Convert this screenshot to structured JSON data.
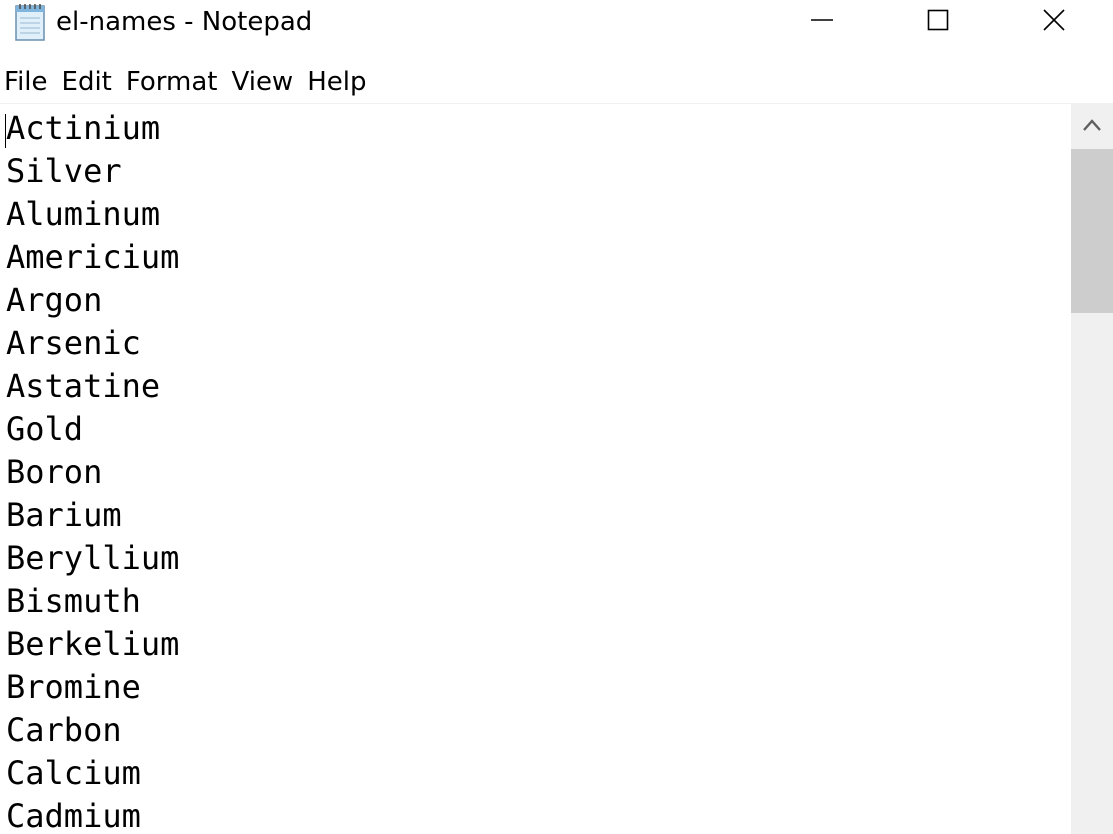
{
  "window": {
    "title": "el-names - Notepad",
    "icon": "notepad-icon",
    "controls": [
      "minimize-icon",
      "maximize-icon",
      "close-icon"
    ]
  },
  "menu": {
    "items": [
      "File",
      "Edit",
      "Format",
      "View",
      "Help"
    ]
  },
  "editor": {
    "lines": [
      "Actinium",
      "Silver",
      "Aluminum",
      "Americium",
      "Argon",
      "Arsenic",
      "Astatine",
      "Gold",
      "Boron",
      "Barium",
      "Beryllium",
      "Bismuth",
      "Berkelium",
      "Bromine",
      "Carbon",
      "Calcium",
      "Cadmium"
    ]
  },
  "scrollbar": {
    "up_icon": "chevron-up-icon"
  },
  "colors": {
    "window_bg": "#ffffff",
    "scroll_track": "#f0f0f0",
    "scroll_thumb": "#cdcdcd",
    "menu_divider": "#f0f0f0"
  }
}
